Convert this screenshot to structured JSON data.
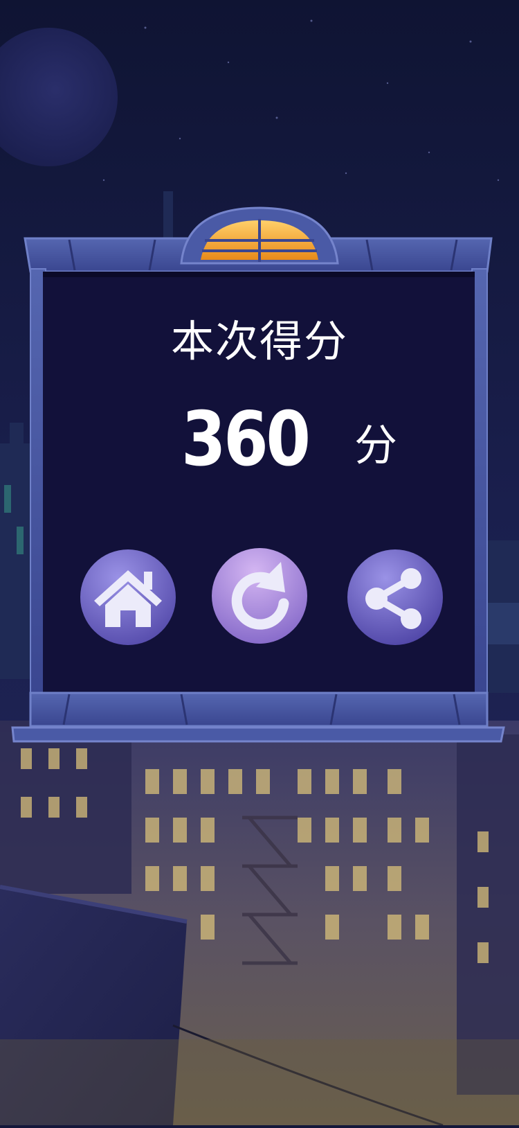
{
  "result": {
    "title": "本次得分",
    "score": "360",
    "unit": "分"
  },
  "buttons": {
    "home_icon": "home-icon",
    "retry_icon": "restart-icon",
    "share_icon": "share-icon"
  },
  "colors": {
    "panel_fill": "#12113a",
    "frame": "#4a5aa6",
    "button_purple": "#7a6fd0",
    "lamp_orange": "#f0a12a"
  }
}
